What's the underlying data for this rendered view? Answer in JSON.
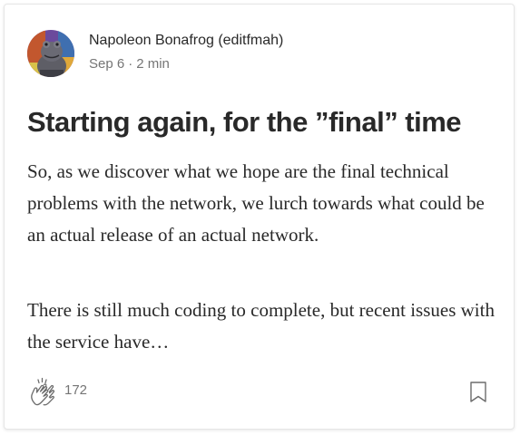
{
  "author": {
    "name": "Napoleon Bonafrog (editfmah)",
    "avatar_icon": "frog-avatar"
  },
  "meta": {
    "date": "Sep 6",
    "separator": "·",
    "read_time": "2 min"
  },
  "post": {
    "title": "Starting again, for the ”final” time",
    "excerpt_1": "So, as we discover what we hope are the final technical problems with the network, we lurch towards what could be an actual release of an actual network.",
    "excerpt_2": "There is still much coding to complete, but recent issues with the service have…"
  },
  "actions": {
    "clap_icon": "clap-icon",
    "clap_count": "172",
    "bookmark_icon": "bookmark-icon"
  },
  "colors": {
    "text_primary": "#292929",
    "text_secondary": "#757575",
    "border": "#e6e6e6"
  }
}
